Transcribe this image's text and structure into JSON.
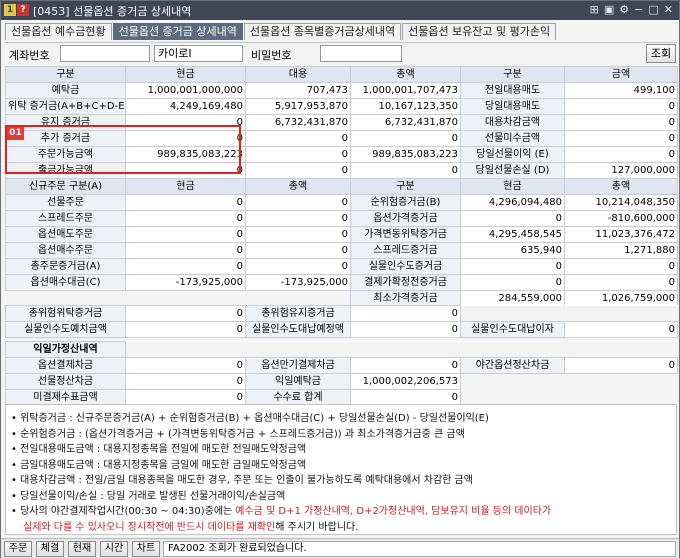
{
  "window": {
    "title": "[0453] 선물옵션 증거금 상세내역"
  },
  "tabs": [
    "선물옵션 예수금현황",
    "선물옵션 증거금 상세내역",
    "선물옵션 종목별증거금상세내역",
    "선물옵션 보유잔고 및 평가손익"
  ],
  "account": {
    "label": "계좌번호",
    "name": "카이로I",
    "pw_label": "비밀번호",
    "query": "조회"
  },
  "t1": {
    "headers": [
      "구분",
      "현금",
      "대용",
      "총액",
      "구분",
      "금액"
    ],
    "rows": [
      [
        "예탁금",
        "1,000,001,000,000",
        "707,473",
        "1,000,001,707,473",
        "전일대용매도",
        "499,100"
      ],
      [
        "위탁 증거금(A+B+C+D-E)",
        "4,249,169,480",
        "5,917,953,870",
        "10,167,123,350",
        "당일대용매도",
        "0"
      ],
      [
        "유지 증거금",
        "0",
        "6,732,431,870",
        "6,732,431,870",
        "대용차감금액",
        "0"
      ],
      [
        "추가 증거금",
        "0",
        "0",
        "0",
        "선물미수금액",
        "0"
      ],
      [
        "주문가능금액",
        "989,835,083,223",
        "0",
        "989,835,083,223",
        "당일선물이익 (E)",
        "0"
      ],
      [
        "출금가능금액",
        "0",
        "0",
        "0",
        "당일선물손실 (D)",
        "127,000,000"
      ]
    ],
    "badge": "01"
  },
  "t2": {
    "headers": [
      "신규주문 구분(A)",
      "현금",
      "총액",
      "구분",
      "현금",
      "총액"
    ],
    "rows": [
      [
        "선물주문",
        "0",
        "0",
        "순위험증거금(B)",
        "4,296,094,480",
        "10,214,048,350"
      ],
      [
        "스프레드주문",
        "0",
        "0",
        "옵션가격증거금",
        "0",
        "-810,600,000"
      ],
      [
        "옵션매도주문",
        "0",
        "0",
        "가격변동위탁증거금",
        "4,295,458,545",
        "11,023,376,472"
      ],
      [
        "옵션매수주문",
        "0",
        "0",
        "스프레드증거금",
        "635,940",
        "1,271,880"
      ],
      [
        "총주문증거금(A)",
        "0",
        "0",
        "실물인수도증거금",
        "0",
        "0"
      ],
      [
        "옵션매수대금(C)",
        "-173,925,000",
        "-173,925,000",
        "결제가확정전증거금",
        "0",
        "0"
      ],
      [
        "",
        "",
        "",
        "최소가격증거금",
        "284,559,000",
        "1,026,759,000"
      ]
    ]
  },
  "t3": {
    "rows": [
      [
        "총위험위탁증거금",
        "0",
        "총위험유지증거금",
        "0",
        "",
        ""
      ],
      [
        "실물인수도예치금액",
        "0",
        "실물인수도대납예정액",
        "0",
        "실물인수도대납이자",
        "0"
      ]
    ]
  },
  "t4": {
    "title": "익일가정산내역",
    "rows": [
      [
        "옵션결제차금",
        "0",
        "옵션만기결제차금",
        "0",
        "야간옵션정산차금",
        "0"
      ],
      [
        "선물정산차금",
        "0",
        "익일예탁금",
        "1,000,002,206,573",
        "",
        ""
      ],
      [
        "미결제수표금액",
        "0",
        "수수료 합계",
        "0",
        "",
        ""
      ]
    ]
  },
  "notes": [
    {
      "t": "위탁증거금 : 신규주문증거금(A) + 순위험증거금(B) + 옵션매수대금(C) + 당일선물손실(D) - 당일선물이익(E)"
    },
    {
      "t": "순위험증거금 : (옵션가격증거금 + (가격변동위탁증거금 + 스프레드증거금)) 과 최소가격증거금중 큰 금액"
    },
    {
      "t": "전일대용매도금액 : 대용지정종목을 전일에 매도한 전일매도약정금액"
    },
    {
      "t": "금일대용매도금액 : 대용지정종목을 금일에 매도한 금일매도약정금액"
    },
    {
      "t": "대용차감금액 : 전일/금일 대용종목을 매도한 경우, 주문 또는 인출이 불가능하도록 예탁대용에서 차감한 금액"
    },
    {
      "t": "당일선물이익/손실 : 당일 거래로 발생된 선물거래이익/손실금액"
    },
    {
      "t": "당사의 야간결제작업시간(00:30 ~ 04:30)중에는",
      "r": "예수금 및 D+1 가정산내역, D+2가정산내역, 담보유지 비율 등의 데이타가"
    },
    {
      "t": "",
      "r": "실제와 다를 수 있사오니 장시작전에 반드시 데이타를 재확인",
      "t2": "해 주시기 바랍니다."
    }
  ],
  "status": {
    "buttons": [
      "주문",
      "체결",
      "현재",
      "시간",
      "차트"
    ],
    "message": "FA2002 조회가 완료되었습니다."
  },
  "colors": {
    "title_bar": "#3f4756",
    "highlight": "#e02020",
    "header_cell": "#dfe6ef",
    "warn_text": "#d21e1e"
  }
}
